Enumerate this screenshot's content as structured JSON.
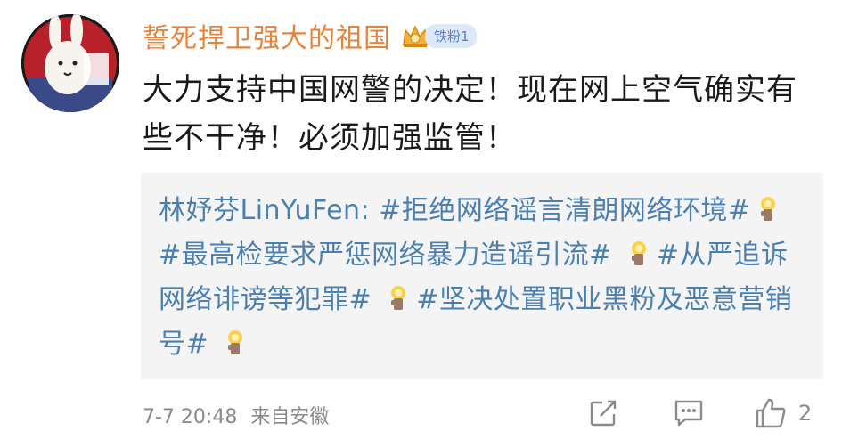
{
  "user": {
    "name": "誓死捍卫强大的祖国",
    "fan_badge": "铁粉1"
  },
  "post": {
    "text": "大力支持中国网警的决定！现在网上空气确实有些不干净！必须加强监管！"
  },
  "repost": {
    "author": "林妤芬LinYuFen:",
    "tag1": "#拒绝网络谣言清朗网络环境#",
    "tag2": "#最高检要求严惩网络暴力造谣引流#",
    "tag3": "#从严追诉网络诽谤等犯罪#",
    "tag4": "#坚决处置职业黑粉及恶意营销号#"
  },
  "footer": {
    "timestamp": "7-7 20:48",
    "source": "来自安徽",
    "like_count": "2"
  },
  "icons": {
    "share": "share-icon",
    "comment": "comment-icon",
    "like": "like-icon",
    "badge": "crown-icon",
    "tag_emoji": "candle-icon"
  },
  "colors": {
    "username": "#e8833a",
    "repost_text": "#4a7fb0",
    "repost_bg": "#f4f4f4",
    "meta": "#8a8a8a"
  }
}
